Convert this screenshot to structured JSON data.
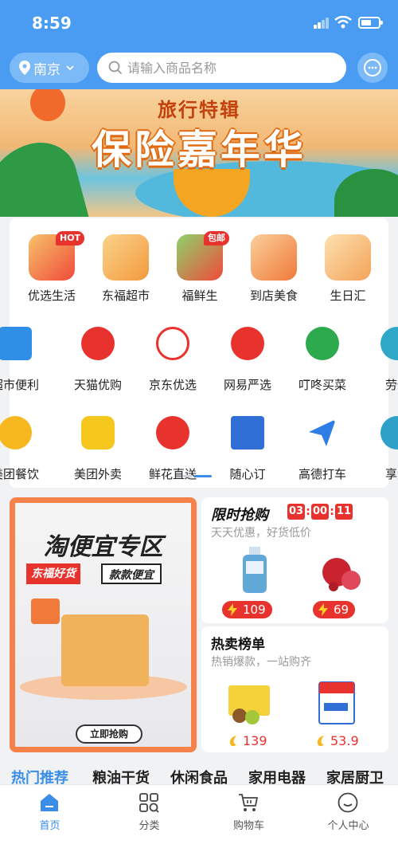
{
  "status": {
    "time": "8:59"
  },
  "header": {
    "city": "南京",
    "search_placeholder": "请输入商品名称"
  },
  "banner": {
    "subtitle": "旅行特辑",
    "title": "保险嘉年华"
  },
  "services": {
    "row1": [
      {
        "label": "优选生活",
        "badge": "HOT",
        "color": "#f04a3a"
      },
      {
        "label": "东福超市",
        "color": "#f29a3c"
      },
      {
        "label": "福鲜生",
        "badge": "包邮",
        "color": "#f04a3a"
      },
      {
        "label": "到店美食",
        "color": "#f07a3a"
      },
      {
        "label": "生日汇",
        "color": "#f3a35a"
      }
    ],
    "row2": [
      {
        "label": "超市便利",
        "color": "#2f8ee6"
      },
      {
        "label": "天猫优购",
        "color": "#e8322d"
      },
      {
        "label": "京东优选",
        "color": "#e8322d"
      },
      {
        "label": "网易严选",
        "color": "#e8322d"
      },
      {
        "label": "叮咚买菜",
        "color": "#2daa4e"
      },
      {
        "label": "劳保",
        "color": "#2fa8c8"
      }
    ],
    "row3": [
      {
        "label": "美团餐饮",
        "color": "#f6b81e"
      },
      {
        "label": "美团外卖",
        "color": "#f6c81e"
      },
      {
        "label": "鲜花直送",
        "color": "#e8322d"
      },
      {
        "label": "随心订",
        "color": "#2f6fd6"
      },
      {
        "label": "高德打车",
        "color": "#2f7ee6"
      },
      {
        "label": "享道",
        "color": "#2fa0c8"
      }
    ],
    "page_dots": {
      "count": 2,
      "active": 1
    }
  },
  "promo": {
    "headline": "淘便宜专区",
    "slogan_red": "东福好货",
    "slogan_black": "款款便宜",
    "button": "立即抢购"
  },
  "flash_sale": {
    "title": "限时抢购",
    "timer": [
      "03",
      "00",
      "11"
    ],
    "subtitle": "天天优惠，好货低价",
    "items": [
      {
        "price": "109",
        "product": "bottle"
      },
      {
        "price": "69",
        "product": "pomegranate"
      }
    ]
  },
  "hot_list": {
    "title": "热卖榜单",
    "subtitle": "热销爆款，一站购齐",
    "items": [
      {
        "price": "139",
        "product": "kiwi-box"
      },
      {
        "price": "53.9",
        "product": "milk-box"
      }
    ]
  },
  "category_tabs": [
    "热门推荐",
    "粮油干货",
    "休闲食品",
    "家用电器",
    "家居厨卫"
  ],
  "tabbar": {
    "items": [
      {
        "label": "首页",
        "icon": "home-icon"
      },
      {
        "label": "分类",
        "icon": "category-icon"
      },
      {
        "label": "购物车",
        "icon": "cart-icon"
      },
      {
        "label": "个人中心",
        "icon": "profile-icon"
      }
    ],
    "active_index": 0
  },
  "colors": {
    "primary": "#4a9cf3",
    "accent": "#e8322d",
    "active_tab": "#3a8ee8"
  }
}
